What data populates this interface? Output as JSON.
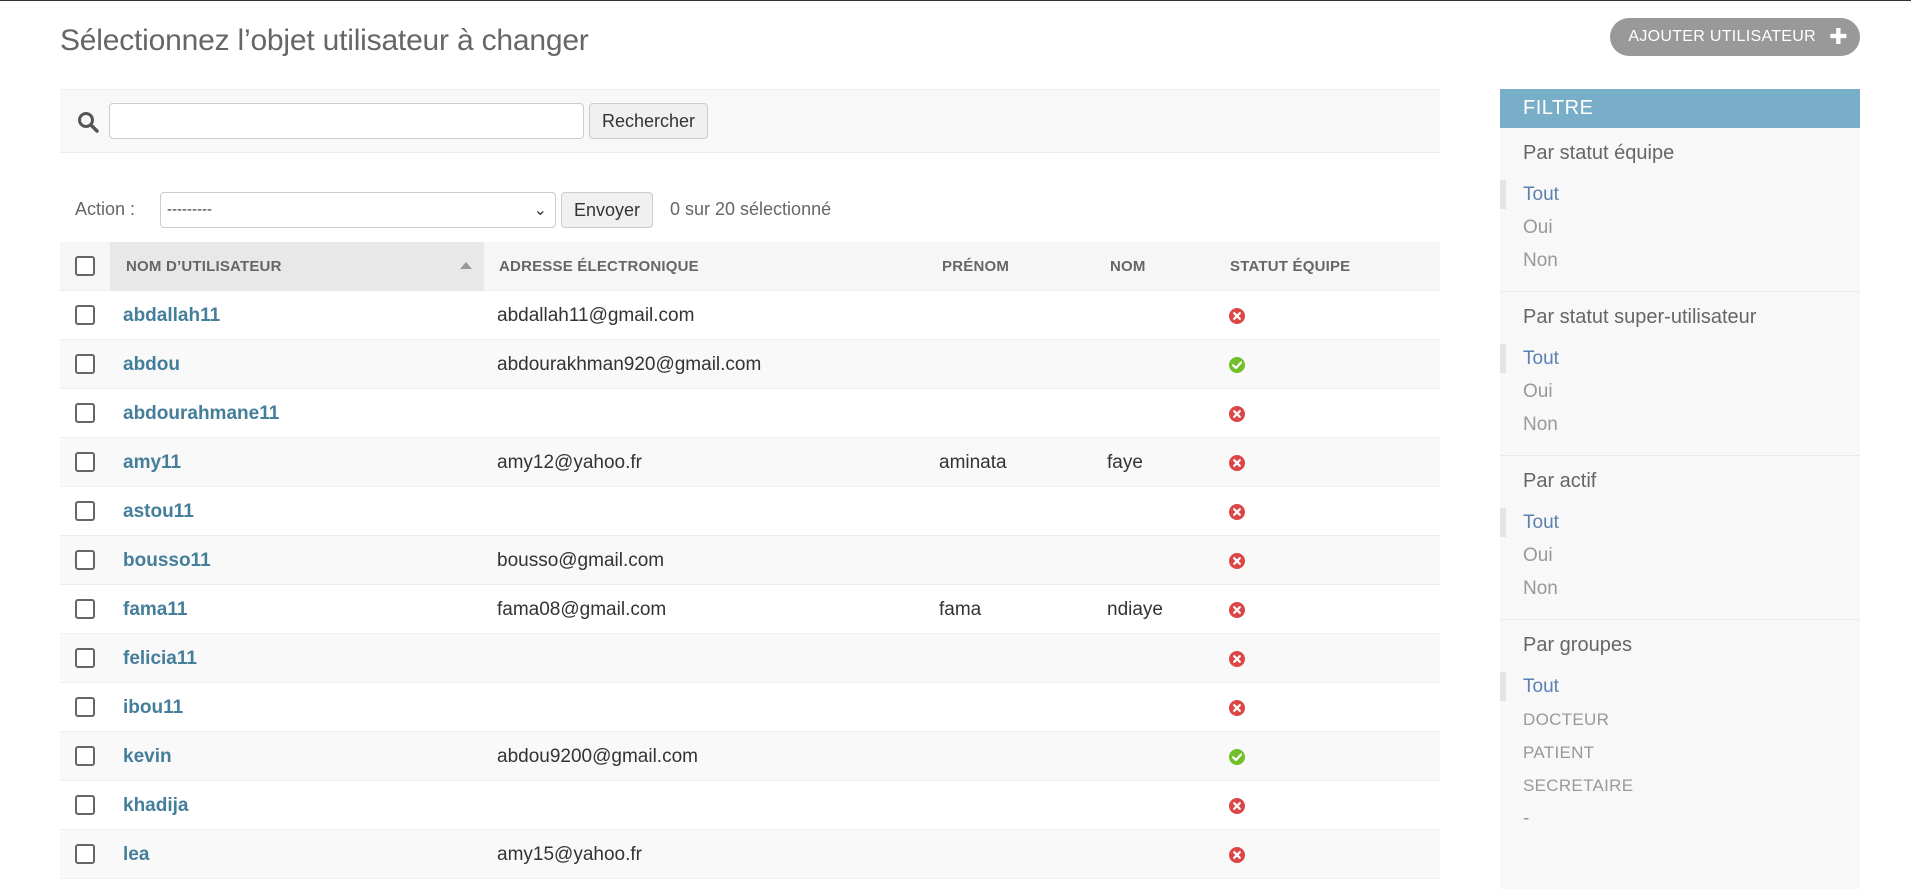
{
  "page": {
    "title": "Sélectionnez l’objet utilisateur à changer",
    "add_button_label": "AJOUTER UTILISATEUR",
    "add_button_icon": "plus-icon"
  },
  "search": {
    "value": "",
    "placeholder": "",
    "button_label": "Rechercher",
    "icon": "search-icon"
  },
  "actions": {
    "label": "Action :",
    "selected_option": "---------",
    "go_label": "Envoyer",
    "selection_count": "0 sur 20 sélectionné"
  },
  "table": {
    "columns": {
      "username": "NOM D’UTILISATEUR",
      "email": "ADRESSE ÉLECTRONIQUE",
      "first_name": "PRÉNOM",
      "last_name": "NOM",
      "staff": "STATUT ÉQUIPE"
    },
    "sort_column": "username",
    "rows": [
      {
        "username": "abdallah11",
        "email": "abdallah11@gmail.com",
        "first_name": "",
        "last_name": "",
        "staff": false
      },
      {
        "username": "abdou",
        "email": "abdourakhman920@gmail.com",
        "first_name": "",
        "last_name": "",
        "staff": true
      },
      {
        "username": "abdourahmane11",
        "email": "",
        "first_name": "",
        "last_name": "",
        "staff": false
      },
      {
        "username": "amy11",
        "email": "amy12@yahoo.fr",
        "first_name": "aminata",
        "last_name": "faye",
        "staff": false
      },
      {
        "username": "astou11",
        "email": "",
        "first_name": "",
        "last_name": "",
        "staff": false
      },
      {
        "username": "bousso11",
        "email": "bousso@gmail.com",
        "first_name": "",
        "last_name": "",
        "staff": false
      },
      {
        "username": "fama11",
        "email": "fama08@gmail.com",
        "first_name": "fama",
        "last_name": "ndiaye",
        "staff": false
      },
      {
        "username": "felicia11",
        "email": "",
        "first_name": "",
        "last_name": "",
        "staff": false
      },
      {
        "username": "ibou11",
        "email": "",
        "first_name": "",
        "last_name": "",
        "staff": false
      },
      {
        "username": "kevin",
        "email": "abdou9200@gmail.com",
        "first_name": "",
        "last_name": "",
        "staff": true
      },
      {
        "username": "khadija",
        "email": "",
        "first_name": "",
        "last_name": "",
        "staff": false
      },
      {
        "username": "lea",
        "email": "amy15@yahoo.fr",
        "first_name": "",
        "last_name": "",
        "staff": false
      }
    ]
  },
  "filter": {
    "title": "FILTRE",
    "sections": [
      {
        "title": "Par statut équipe",
        "items": [
          "Tout",
          "Oui",
          "Non"
        ],
        "selected": 0
      },
      {
        "title": "Par statut super-utilisateur",
        "items": [
          "Tout",
          "Oui",
          "Non"
        ],
        "selected": 0
      },
      {
        "title": "Par actif",
        "items": [
          "Tout",
          "Oui",
          "Non"
        ],
        "selected": 0
      },
      {
        "title": "Par groupes",
        "items": [
          "Tout",
          "DOCTEUR",
          "PATIENT",
          "SECRETAIRE",
          "-"
        ],
        "selected": 0
      }
    ]
  },
  "colors": {
    "link": "#447e9b",
    "filter_header": "#79aec8",
    "status_yes": "#70bf2b",
    "status_no": "#dd4646"
  }
}
